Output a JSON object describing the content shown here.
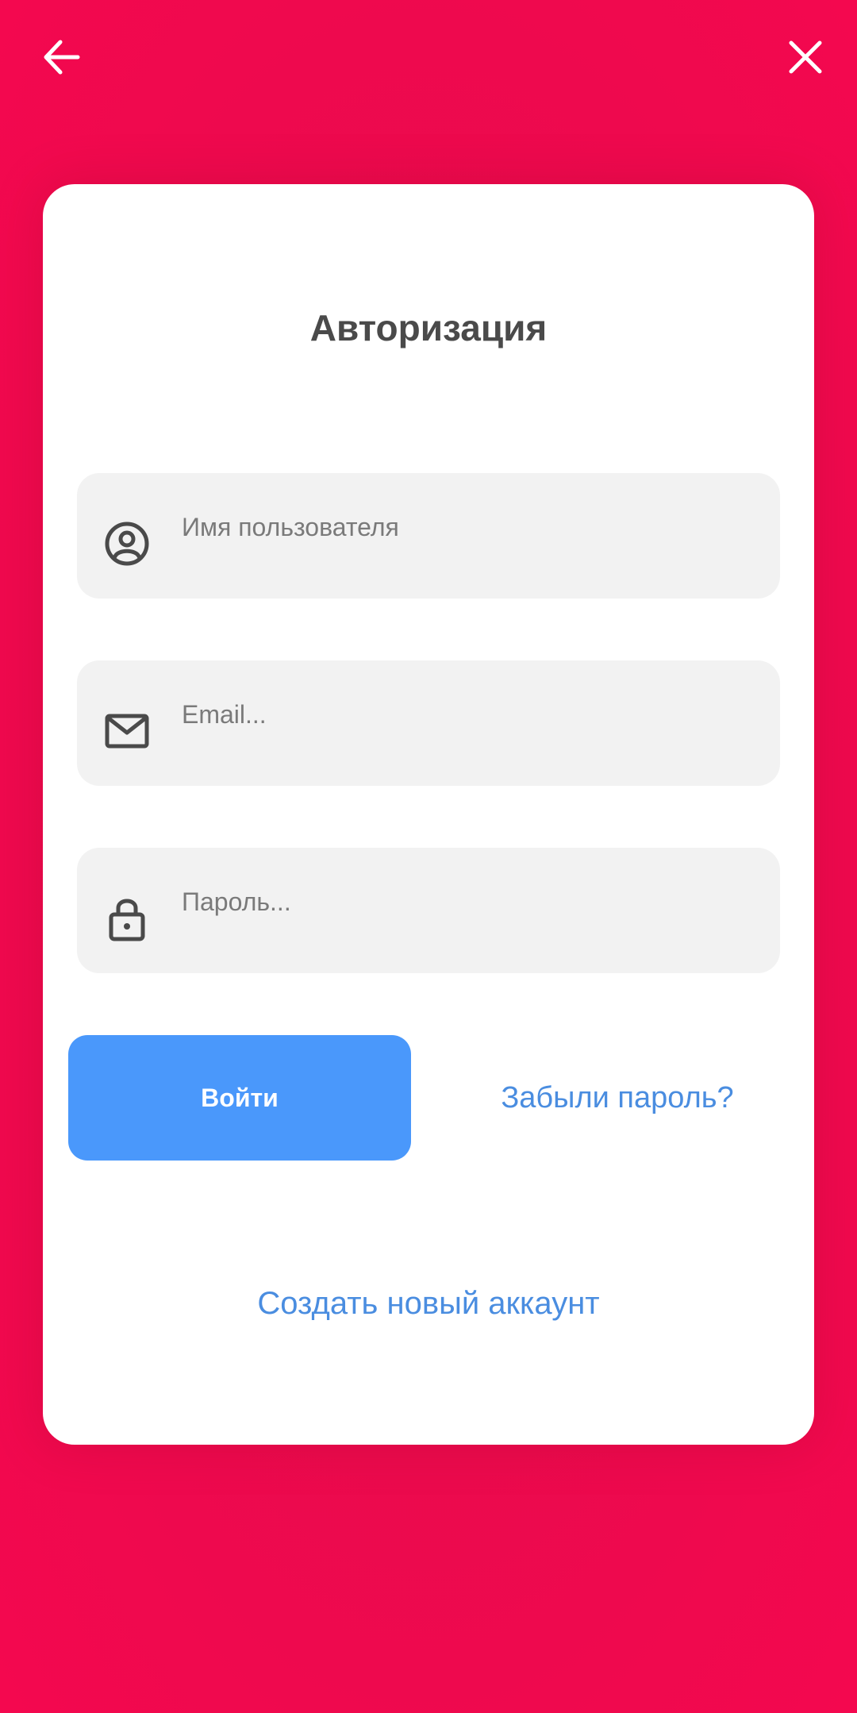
{
  "topbar": {
    "back_icon": "arrow-left-icon",
    "close_icon": "close-icon"
  },
  "auth": {
    "title": "Авторизация",
    "fields": {
      "username": {
        "placeholder": "Имя пользователя",
        "value": "",
        "icon": "user-circle-icon"
      },
      "email": {
        "placeholder": "Email...",
        "value": "",
        "icon": "envelope-icon"
      },
      "password": {
        "placeholder": "Пароль...",
        "value": "",
        "icon": "lock-icon"
      }
    },
    "login_label": "Войти",
    "forgot_label": "Забыли пароль?",
    "create_label": "Создать новый аккаунт"
  },
  "colors": {
    "background": "#ea0a4d",
    "card": "#ffffff",
    "field": "#f2f2f2",
    "primary_button": "#4a98fb",
    "link": "#4a8de0",
    "title_text": "#4a4a4a",
    "icon": "#4a4a4a"
  }
}
